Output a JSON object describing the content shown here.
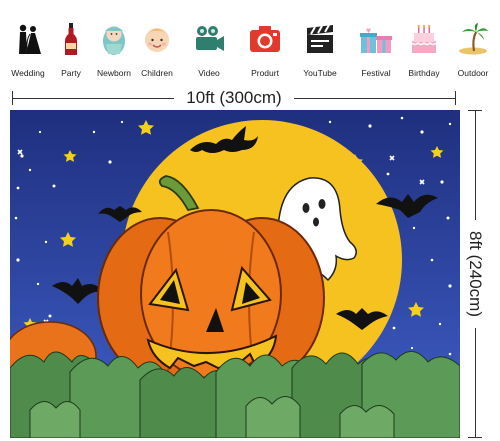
{
  "categories": [
    {
      "label": "Wedding",
      "icon": "wedding-couple-icon"
    },
    {
      "label": "Party",
      "icon": "wine-bottle-icon"
    },
    {
      "label": "Newborn",
      "icon": "newborn-baby-icon"
    },
    {
      "label": "Children",
      "icon": "child-face-icon"
    },
    {
      "label": "Video",
      "icon": "video-camera-icon"
    },
    {
      "label": "Produrt",
      "icon": "photo-camera-icon"
    },
    {
      "label": "YouTube",
      "icon": "clapperboard-icon"
    },
    {
      "label": "Festival",
      "icon": "gift-boxes-icon"
    },
    {
      "label": "Birthday",
      "icon": "birthday-cake-icon"
    },
    {
      "label": "Outdoor",
      "icon": "palm-island-icon"
    }
  ],
  "dimensions": {
    "width_label": "10ft (300cm)",
    "height_label": "8ft (240cm)"
  },
  "backdrop": {
    "theme": "halloween-pumpkin-moon-night",
    "colors": {
      "sky_top": "#1f2f7e",
      "sky_bottom": "#3f5fc8",
      "moon": "#f6c21f",
      "pumpkin": "#f07a1c",
      "leaves": "#4f8b4a",
      "ghost": "#ffffff"
    }
  }
}
